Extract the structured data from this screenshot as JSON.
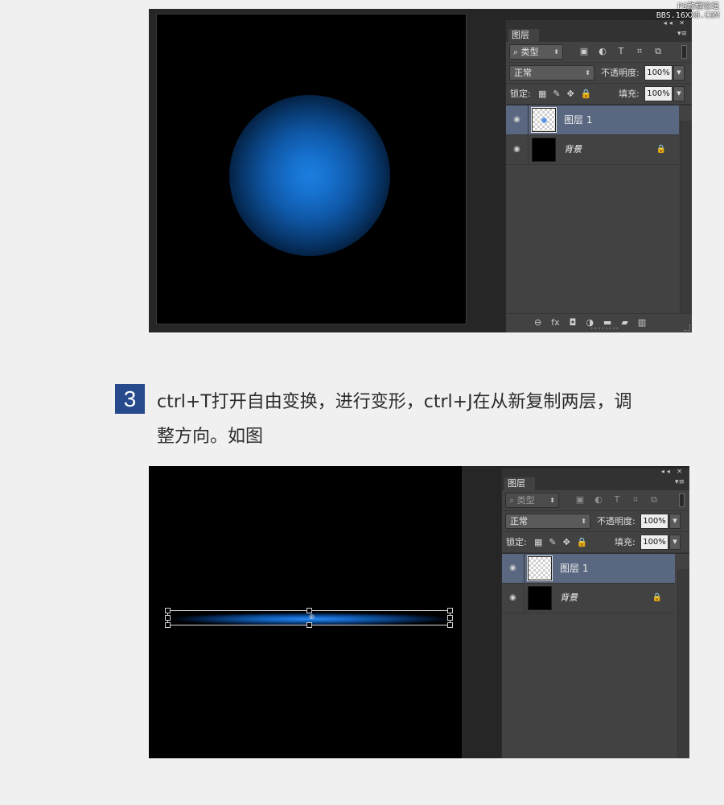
{
  "watermark": {
    "line1": "PS教程论坛",
    "line2": "BBS.16XX8.COM"
  },
  "step": {
    "number": "3",
    "text_line1": "ctrl+T打开自由变换，进行变形，ctrl+J在从新复制两层，调",
    "text_line2": "整方向。如图"
  },
  "panel1": {
    "tab_label": "图层",
    "filter_label": "类型",
    "blend_mode": "正常",
    "opacity_label": "不透明度:",
    "opacity_value": "100%",
    "lock_label": "锁定:",
    "fill_label": "填充:",
    "fill_value": "100%",
    "layers": [
      {
        "name": "图层 1",
        "selected": true
      },
      {
        "name": "背景",
        "selected": false
      }
    ]
  },
  "panel2": {
    "tab_label": "图层",
    "filter_label": "类型",
    "blend_mode": "正常",
    "opacity_label": "不透明度:",
    "opacity_value": "100%",
    "lock_label": "锁定:",
    "fill_label": "填充:",
    "fill_value": "100%",
    "layers": [
      {
        "name": "图层 1",
        "selected": true
      },
      {
        "name": "背景",
        "selected": false
      }
    ]
  },
  "icons": {
    "search": "⌕",
    "image": "▣",
    "adjust": "◐",
    "type": "T",
    "shape": "⌗",
    "smart": "⧉",
    "checker_lock": "▦",
    "brush_lock": "✎",
    "move_lock": "✥",
    "padlock": "🔒",
    "eye": "◉",
    "link": "⊖",
    "fx": "fx",
    "mask": "◘",
    "adjustment": "◑",
    "folder": "▬",
    "new": "▰",
    "trash": "▥"
  },
  "colors": {
    "accent_badge": "#274a8c",
    "selected_layer": "#596780",
    "glow": "#1c7ee0"
  }
}
